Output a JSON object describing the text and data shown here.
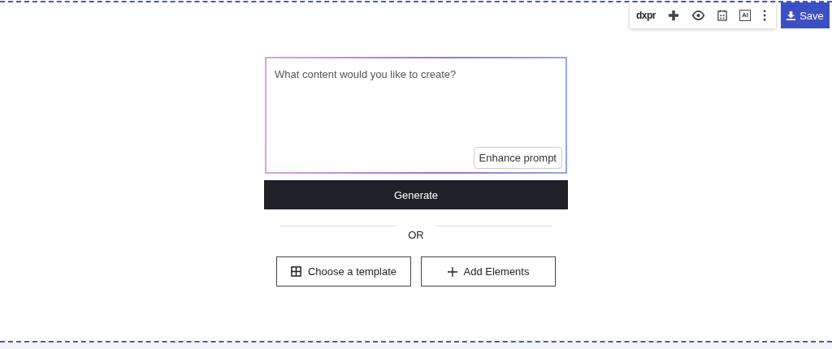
{
  "toolbar": {
    "logo": "dxpr",
    "ai_label": "AI",
    "save": "Save"
  },
  "prompt": {
    "placeholder": "What content would you like to create?",
    "enhance": "Enhance prompt"
  },
  "generate": "Generate",
  "separator": "OR",
  "actions": [
    {
      "kind": "template",
      "label": "Choose a template"
    },
    {
      "kind": "add",
      "label": "Add Elements"
    }
  ]
}
